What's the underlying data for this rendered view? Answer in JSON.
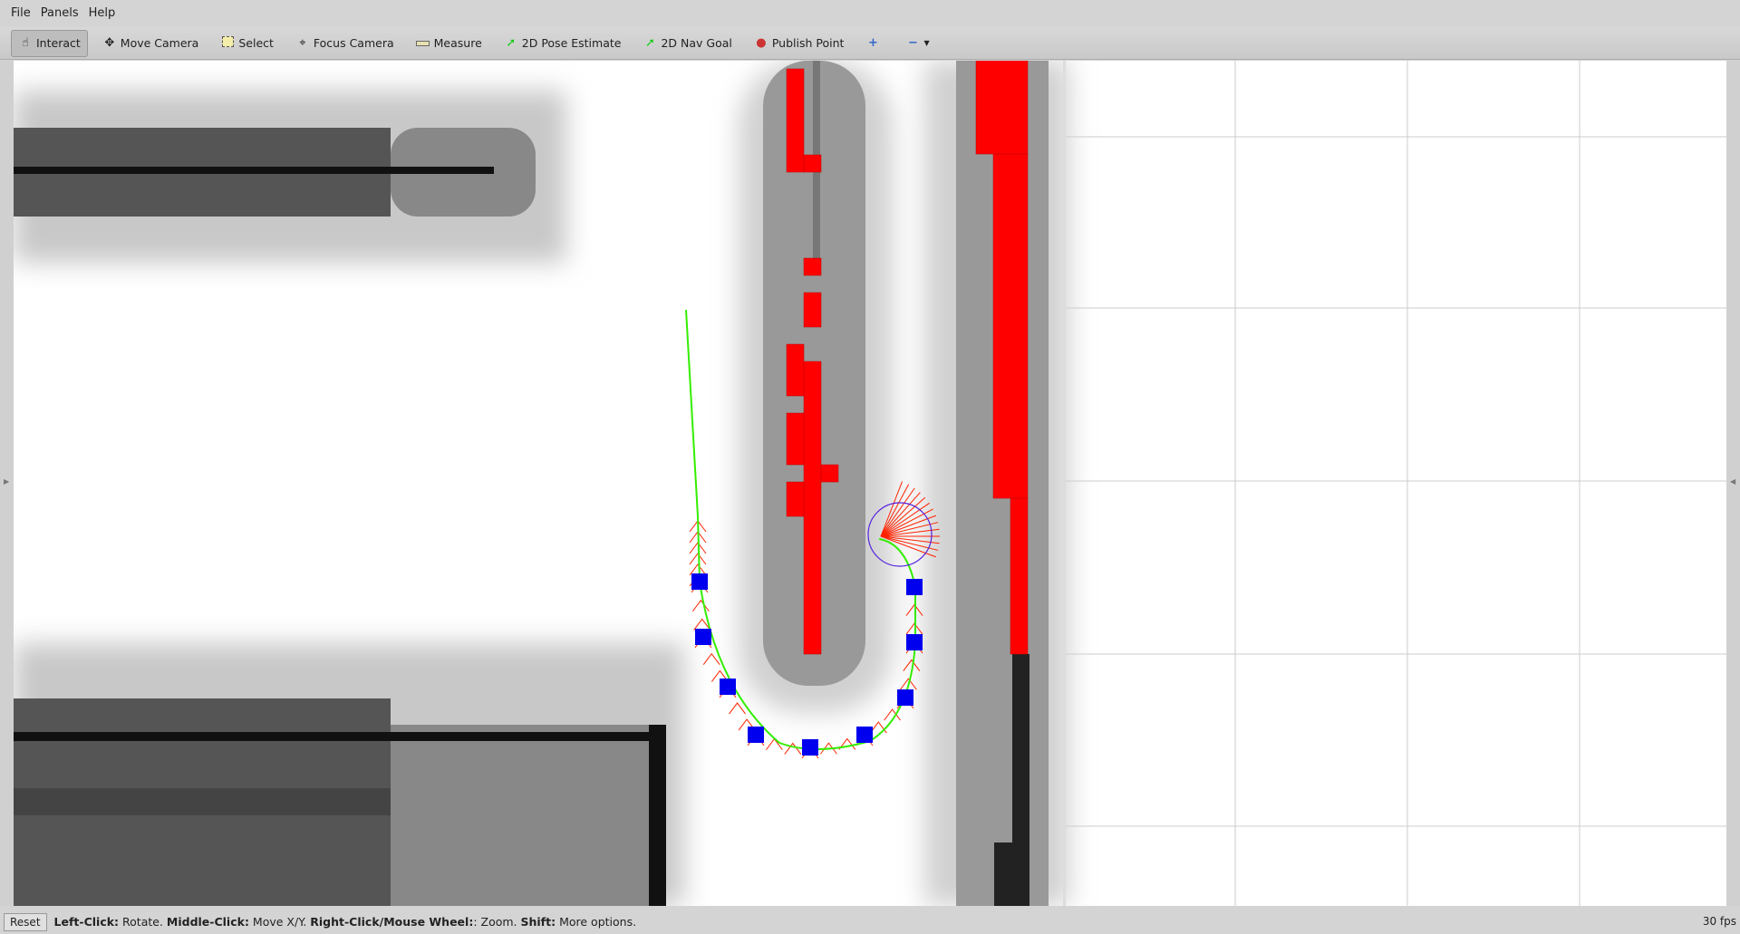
{
  "menu": {
    "items": [
      "File",
      "Panels",
      "Help"
    ]
  },
  "toolbar": {
    "tools": [
      {
        "label": "Interact",
        "icon": "hand-icon"
      },
      {
        "label": "Move Camera",
        "icon": "move-icon"
      },
      {
        "label": "Select",
        "icon": "select-box-icon"
      },
      {
        "label": "Focus Camera",
        "icon": "crosshair-icon"
      },
      {
        "label": "Measure",
        "icon": "ruler-icon"
      },
      {
        "label": "2D Pose Estimate",
        "icon": "green-arrow-icon"
      },
      {
        "label": "2D Nav Goal",
        "icon": "green-arrow-icon"
      },
      {
        "label": "Publish Point",
        "icon": "map-pin-icon"
      }
    ],
    "active": "Interact"
  },
  "colors": {
    "obstacle": "#ff0000",
    "waypoint": "#0000ee",
    "path": "#33ee00",
    "trajectory": "#ff2200",
    "footprint": "#5522dd"
  },
  "status": {
    "reset_label": "Reset",
    "hints": [
      {
        "key": "Left-Click:",
        "text": " Rotate. "
      },
      {
        "key": "Middle-Click:",
        "text": " Move X/Y. "
      },
      {
        "key": "Right-Click/Mouse Wheel:",
        "text": ": Zoom. "
      },
      {
        "key": "Shift:",
        "text": " More options."
      }
    ],
    "fps": "30 fps"
  }
}
